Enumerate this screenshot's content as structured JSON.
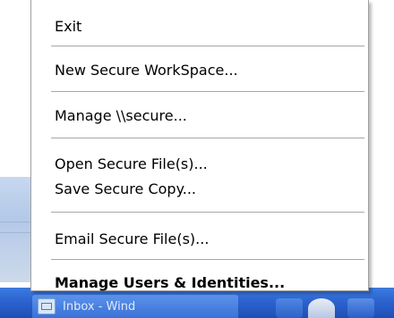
{
  "menu": {
    "items": [
      {
        "label": "Exit"
      },
      {
        "label": "New Secure WorkSpace..."
      },
      {
        "label": "Manage \\\\secure..."
      },
      {
        "label": "Open Secure File(s)..."
      },
      {
        "label": "Save Secure Copy..."
      },
      {
        "label": "Email Secure File(s)..."
      },
      {
        "label": "Manage Users & Identities...",
        "bold": true
      }
    ]
  },
  "taskbar": {
    "button_label": "Inbox - Wind"
  },
  "colors": {
    "taskbar": "#2c63cf",
    "menu_background": "#ffffff",
    "separator": "#a7a7a7"
  },
  "icons": {
    "taskbar_app": "inbox-icon"
  }
}
